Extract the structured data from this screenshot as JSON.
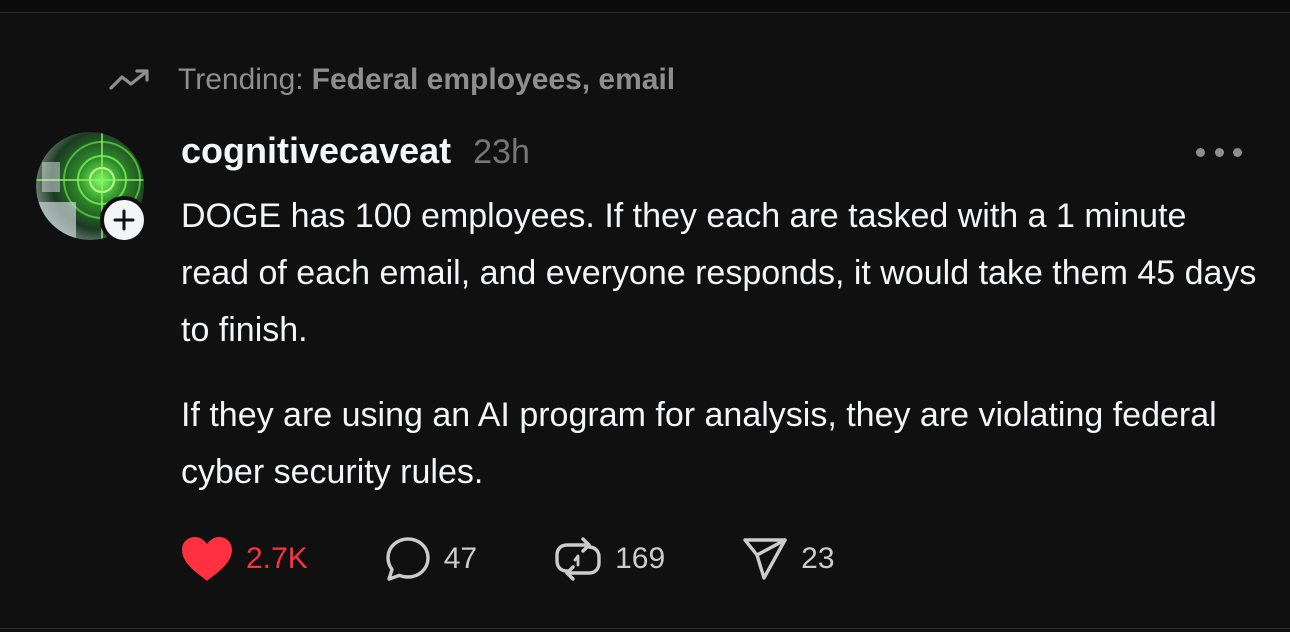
{
  "trending": {
    "label": "Trending:",
    "topic": "Federal employees, email",
    "icon": "trending-up-icon"
  },
  "post": {
    "username": "cognitivecaveat",
    "timestamp": "23h",
    "paragraphs": [
      "DOGE has 100 employees. If they each are tasked with a 1 minute read of each email, and everyone responds, it would take them 45 days to finish.",
      "If they are using an AI program for analysis, they are violating federal cyber security rules."
    ]
  },
  "actions": {
    "likes": "2.7K",
    "replies": "47",
    "reposts": "169",
    "shares": "23"
  },
  "colors": {
    "background": "#101010",
    "text": "#f3f5f7",
    "muted": "#8e8e8e",
    "like": "#ff3040"
  }
}
